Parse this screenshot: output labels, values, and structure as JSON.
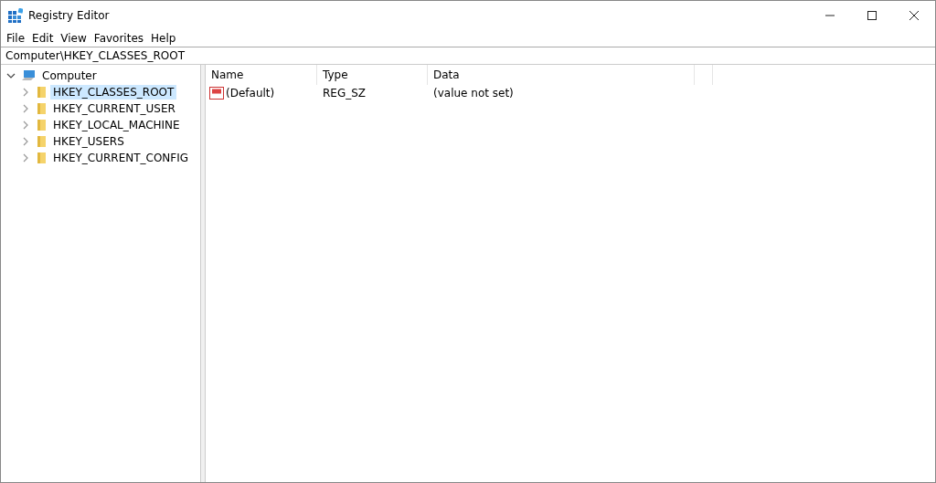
{
  "window": {
    "title": "Registry Editor"
  },
  "menu": [
    "File",
    "Edit",
    "View",
    "Favorites",
    "Help"
  ],
  "address_bar": {
    "value": "Computer\\HKEY_CLASSES_ROOT"
  },
  "tree": [
    {
      "label": "Computer",
      "kind": "computer",
      "expanded": true,
      "selected": false,
      "children": [
        {
          "label": "HKEY_CLASSES_ROOT",
          "kind": "folder",
          "expanded": false,
          "selected": true
        },
        {
          "label": "HKEY_CURRENT_USER",
          "kind": "folder",
          "expanded": false,
          "selected": false
        },
        {
          "label": "HKEY_LOCAL_MACHINE",
          "kind": "folder",
          "expanded": false,
          "selected": false
        },
        {
          "label": "HKEY_USERS",
          "kind": "folder",
          "expanded": false,
          "selected": false
        },
        {
          "label": "HKEY_CURRENT_CONFIG",
          "kind": "folder",
          "expanded": false,
          "selected": false
        }
      ]
    }
  ],
  "table": {
    "columns": [
      "Name",
      "Type",
      "Data"
    ],
    "rows": [
      {
        "kind": "string",
        "name": "(Default)",
        "type": "REG_SZ",
        "data": "(value not set)"
      }
    ]
  }
}
